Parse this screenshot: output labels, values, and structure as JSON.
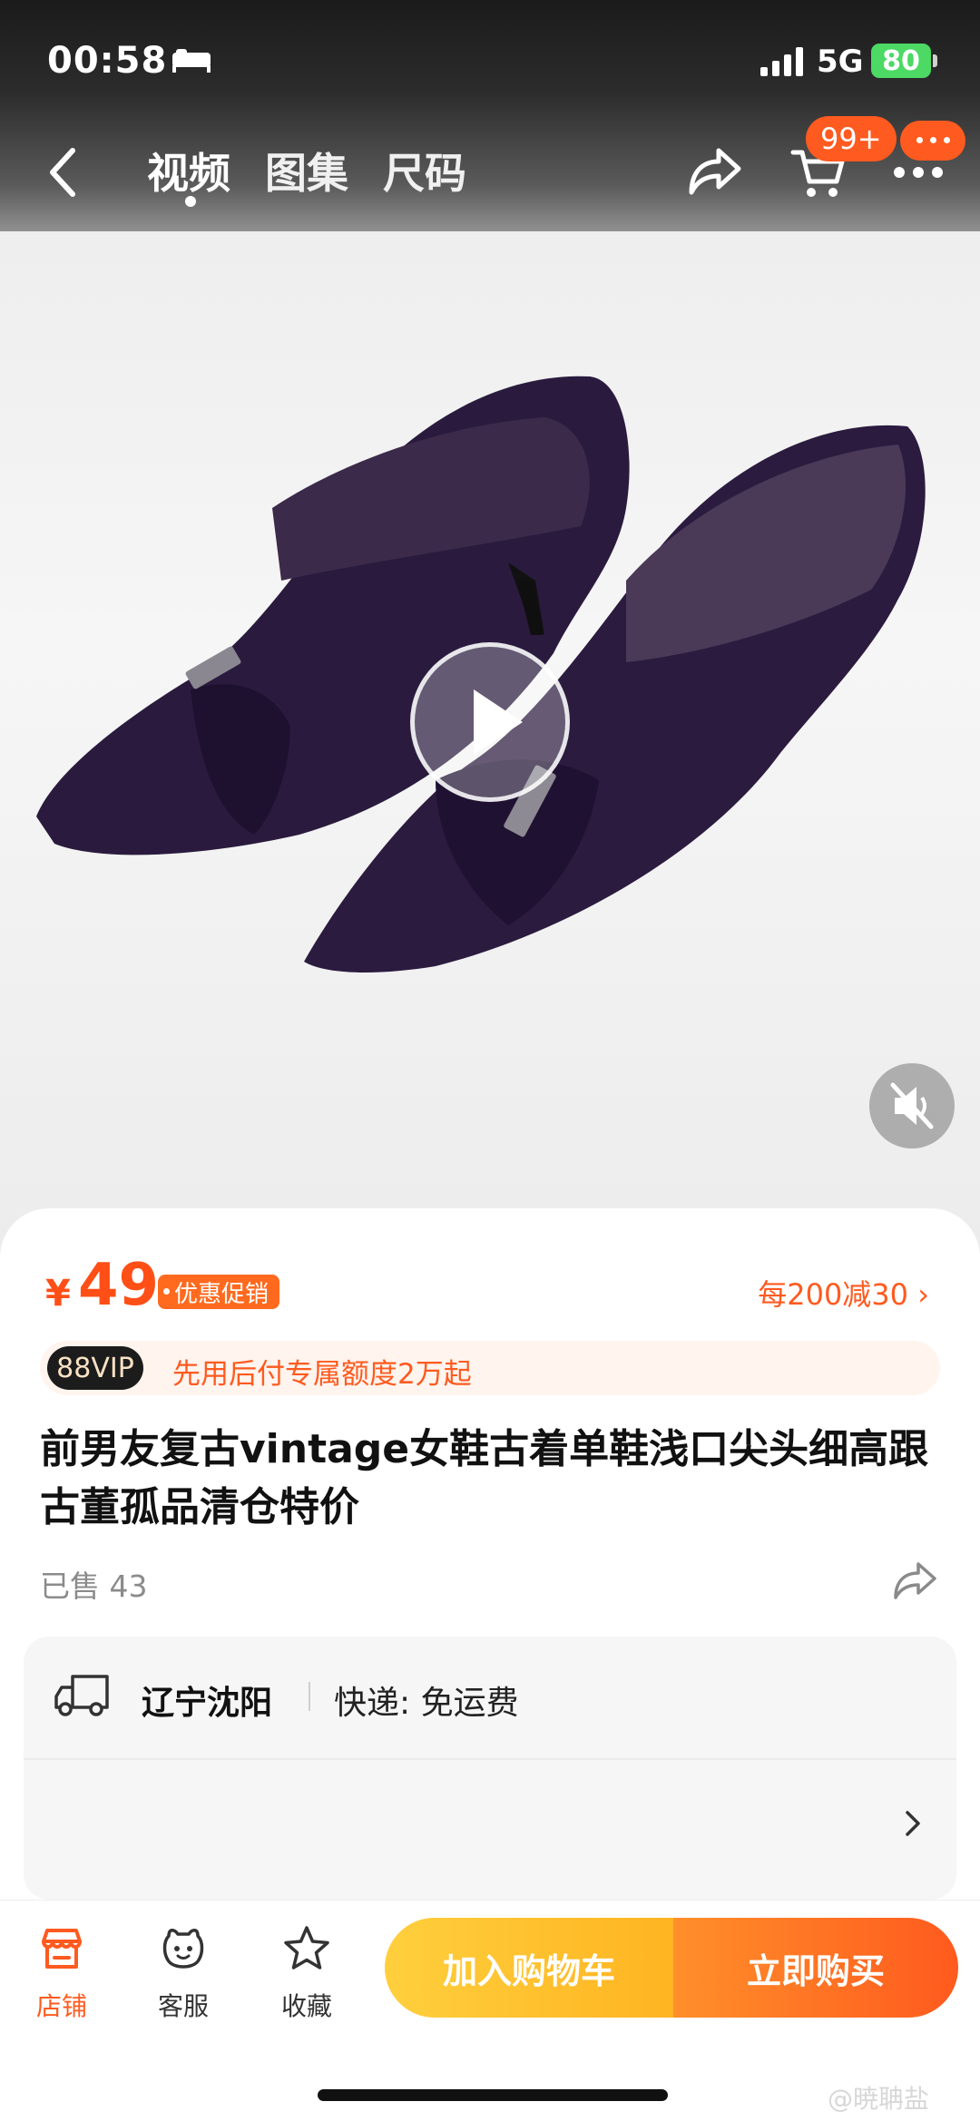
{
  "status_bar": {
    "time": "00:58",
    "network": "5G",
    "battery": "80"
  },
  "nav": {
    "tabs": [
      {
        "label": "视频",
        "active": true
      },
      {
        "label": "图集",
        "active": false
      },
      {
        "label": "尺码",
        "active": false
      }
    ],
    "cart_badge": "99+"
  },
  "media": {
    "video_playing": false,
    "muted": true
  },
  "product": {
    "currency": "¥",
    "price": "49",
    "promo_tag": "优惠促销",
    "discount_rule": "每200减30 ›",
    "vip_badge": "88VIP",
    "vip_text": "先用后付专属额度2万起",
    "title": "前男友复古vintage女鞋古着单鞋浅口尖头细高跟古董孤品清仓特价",
    "sold": "已售 43"
  },
  "shipping": {
    "city": "辽宁沈阳",
    "method": "快递: 免运费"
  },
  "bottom_bar": {
    "shop_label": "店铺",
    "service_label": "客服",
    "favorite_label": "收藏",
    "add_to_cart": "加入购物车",
    "buy_now": "立即购买"
  },
  "watermark": "@暁聃盐",
  "colors": {
    "accent": "#ff5a1f",
    "cart_button": "#ffbf2e",
    "buy_button": "#ff6a22"
  }
}
